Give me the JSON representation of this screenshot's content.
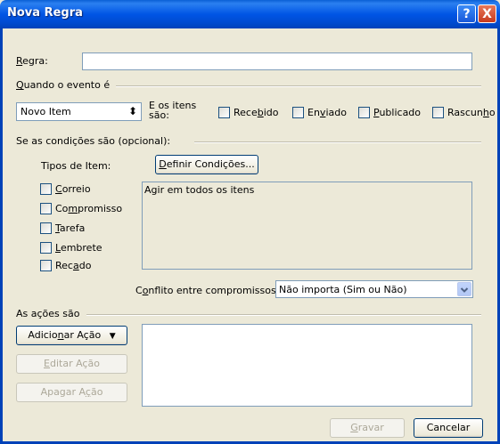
{
  "window": {
    "title": "Nova Regra",
    "help_label": "?",
    "close_label": "X"
  },
  "rule": {
    "label_prefix": "R",
    "label_rest": "egra:",
    "value": ""
  },
  "event_group": {
    "label_u": "Q",
    "label_rest": "uando o evento é"
  },
  "event_select": {
    "value": "Novo Item",
    "arrow": "⬍"
  },
  "items_label": {
    "line1": "E os itens",
    "line2": "são:"
  },
  "item_kinds": [
    {
      "pre": "Rece",
      "u": "b",
      "post": "ido",
      "checked": false
    },
    {
      "pre": "En",
      "u": "v",
      "post": "iado",
      "checked": false
    },
    {
      "pre": "",
      "u": "P",
      "post": "ublicado",
      "checked": false
    },
    {
      "pre": "Rascun",
      "u": "h",
      "post": "o",
      "checked": false
    }
  ],
  "conditions_group": {
    "label": "Se as condições são (opcional):"
  },
  "item_types_label": "Tipos de Item:",
  "define_conditions": {
    "u": "D",
    "rest": "efinir Condições..."
  },
  "item_types": [
    {
      "pre": "",
      "u": "C",
      "post": "orreio"
    },
    {
      "pre": "Co",
      "u": "m",
      "post": "promisso"
    },
    {
      "pre": "",
      "u": "T",
      "post": "arefa"
    },
    {
      "pre": "",
      "u": "L",
      "post": "embrete"
    },
    {
      "pre": "Rec",
      "u": "a",
      "post": "do"
    }
  ],
  "conditions_text": "Agir em todos os itens",
  "conflict": {
    "label_u": "o",
    "label_pre": "C",
    "label_post": "nflito entre compromissos:",
    "value": "Não importa (Sim ou Não)"
  },
  "actions_group": {
    "label": "As ações são"
  },
  "add_action": {
    "pre": "Adicio",
    "u": "n",
    "post": "ar Ação",
    "arrow": "▼"
  },
  "edit_action": {
    "pre": "",
    "u": "E",
    "post": "ditar Ação"
  },
  "delete_action": {
    "pre": "Apagar A",
    "u": "ç",
    "post": "ão"
  },
  "footer": {
    "save_u": "G",
    "save_rest": "ravar",
    "cancel": "Cancelar"
  }
}
